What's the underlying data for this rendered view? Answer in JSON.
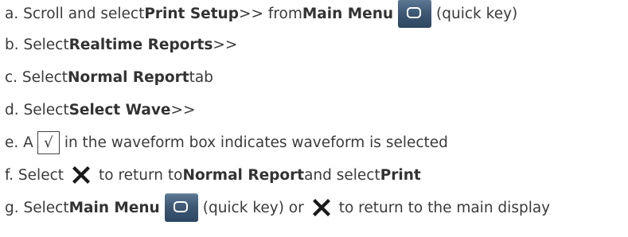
{
  "steps": [
    {
      "prefix": "a. Scroll and select ",
      "bold1": "Print Setup",
      "mid1": " >> from ",
      "bold2": "Main Menu",
      "suffix": "(quick key)"
    },
    {
      "prefix": "b. Select ",
      "bold1": "Realtime Reports",
      "suffix": " >>"
    },
    {
      "prefix": "c. Select ",
      "bold1": "Normal Report",
      "suffix": " tab"
    },
    {
      "prefix": "d. Select ",
      "bold1": "Select Wave",
      "suffix": " >>"
    },
    {
      "prefix": "e. A",
      "check_glyph": "√",
      "suffix": "in the waveform box indicates waveform is selected"
    },
    {
      "prefix": "f.  Select",
      "mid1": "to return to ",
      "bold1": "Normal Report",
      "mid2": " and select ",
      "bold2": "Print"
    },
    {
      "prefix": "g. Select ",
      "bold1": "Main Menu",
      "mid1": "(quick key) or",
      "suffix": "to return to the main display"
    }
  ],
  "icons": {
    "main_menu_key": "main-menu-key-icon",
    "close": "close-x-icon",
    "check": "checkmark-box-icon"
  },
  "colors": {
    "text": "#3a3a3a",
    "key_top": "#5f7a95",
    "key_bottom": "#2d4560",
    "x_icon": "#1a1a1a"
  }
}
